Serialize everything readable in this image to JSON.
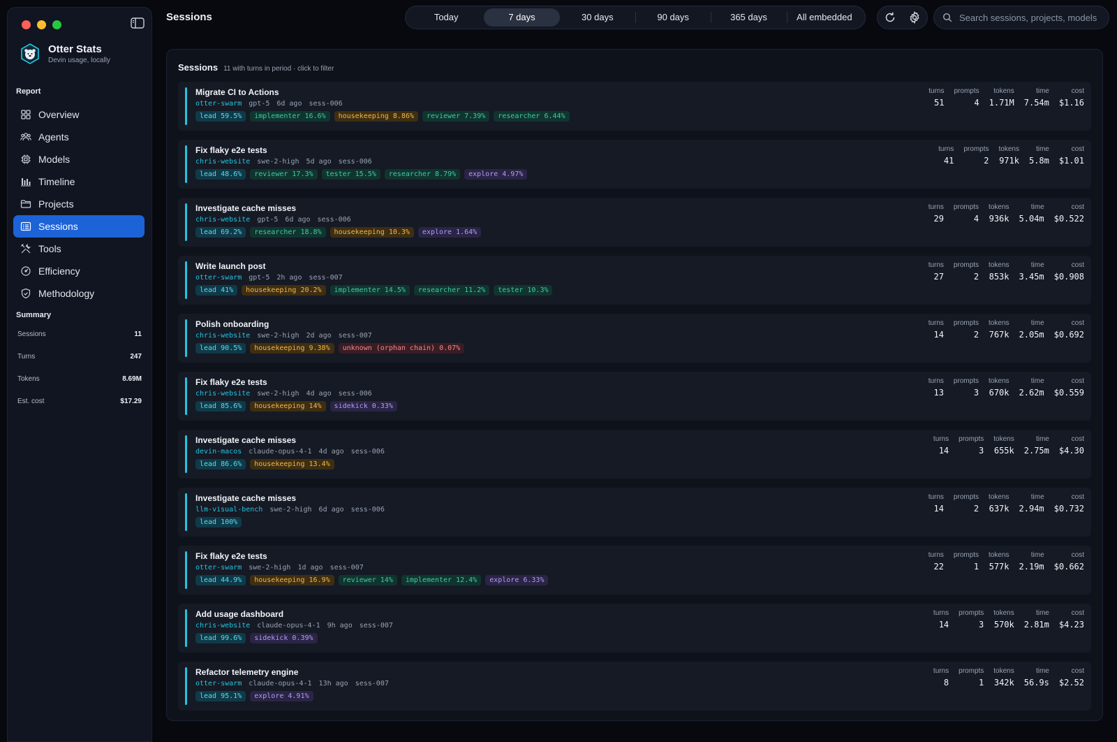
{
  "app": {
    "name": "Otter Stats",
    "subtitle": "Devin usage, locally"
  },
  "header": {
    "title": "Sessions"
  },
  "ranges": [
    {
      "label": "Today",
      "active": false
    },
    {
      "label": "7 days",
      "active": true
    },
    {
      "label": "30 days",
      "active": false
    },
    {
      "label": "90 days",
      "active": false
    },
    {
      "label": "365 days",
      "active": false
    },
    {
      "label": "All embedded",
      "active": false
    }
  ],
  "search": {
    "placeholder": "Search sessions, projects, models"
  },
  "sidebar": {
    "report_label": "Report",
    "items": [
      {
        "label": "Overview",
        "icon": "grid-icon",
        "active": false
      },
      {
        "label": "Agents",
        "icon": "users-icon",
        "active": false
      },
      {
        "label": "Models",
        "icon": "chip-icon",
        "active": false
      },
      {
        "label": "Timeline",
        "icon": "bar-chart-icon",
        "active": false
      },
      {
        "label": "Projects",
        "icon": "folder-icon",
        "active": false
      },
      {
        "label": "Sessions",
        "icon": "list-icon",
        "active": true
      },
      {
        "label": "Tools",
        "icon": "tools-icon",
        "active": false
      },
      {
        "label": "Efficiency",
        "icon": "gauge-icon",
        "active": false
      },
      {
        "label": "Methodology",
        "icon": "shield-icon",
        "active": false
      }
    ],
    "summary_label": "Summary",
    "summary": [
      {
        "label": "Sessions",
        "value": "11"
      },
      {
        "label": "Turns",
        "value": "247"
      },
      {
        "label": "Tokens",
        "value": "8.69M"
      },
      {
        "label": "Est. cost",
        "value": "$17.29"
      }
    ]
  },
  "panel": {
    "title": "Sessions",
    "subtitle": "11 with turns in period · click to filter"
  },
  "stat_labels": {
    "turns": "turns",
    "prompts": "prompts",
    "tokens": "tokens",
    "time": "time",
    "cost": "cost"
  },
  "sessions": [
    {
      "title": "Migrate CI to Actions",
      "project": "otter-swarm",
      "model": "gpt-5",
      "age": "6d ago",
      "id": "sess-006",
      "pills": [
        {
          "t": "lead 59.5%",
          "c": "lead"
        },
        {
          "t": "implementer 16.6%",
          "c": "green"
        },
        {
          "t": "housekeeping 8.86%",
          "c": "housekeeping"
        },
        {
          "t": "reviewer 7.39%",
          "c": "green"
        },
        {
          "t": "researcher 6.44%",
          "c": "green"
        }
      ],
      "turns": "51",
      "prompts": "4",
      "tokens": "1.71M",
      "time": "7.54m",
      "cost": "$1.16"
    },
    {
      "title": "Fix flaky e2e tests",
      "project": "chris-website",
      "model": "swe-2-high",
      "age": "5d ago",
      "id": "sess-006",
      "pills": [
        {
          "t": "lead 48.6%",
          "c": "lead"
        },
        {
          "t": "reviewer 17.3%",
          "c": "green"
        },
        {
          "t": "tester 15.5%",
          "c": "green"
        },
        {
          "t": "researcher 8.79%",
          "c": "green"
        },
        {
          "t": "explore 4.97%",
          "c": "explore"
        }
      ],
      "turns": "41",
      "prompts": "2",
      "tokens": "971k",
      "time": "5.8m",
      "cost": "$1.01"
    },
    {
      "title": "Investigate cache misses",
      "project": "chris-website",
      "model": "gpt-5",
      "age": "6d ago",
      "id": "sess-006",
      "pills": [
        {
          "t": "lead 69.2%",
          "c": "lead"
        },
        {
          "t": "researcher 18.8%",
          "c": "green"
        },
        {
          "t": "housekeeping 10.3%",
          "c": "housekeeping"
        },
        {
          "t": "explore 1.64%",
          "c": "explore"
        }
      ],
      "turns": "29",
      "prompts": "4",
      "tokens": "936k",
      "time": "5.04m",
      "cost": "$0.522"
    },
    {
      "title": "Write launch post",
      "project": "otter-swarm",
      "model": "gpt-5",
      "age": "2h ago",
      "id": "sess-007",
      "pills": [
        {
          "t": "lead 41%",
          "c": "lead"
        },
        {
          "t": "housekeeping 20.2%",
          "c": "housekeeping"
        },
        {
          "t": "implementer 14.5%",
          "c": "green"
        },
        {
          "t": "researcher 11.2%",
          "c": "green"
        },
        {
          "t": "tester 10.3%",
          "c": "green"
        }
      ],
      "turns": "27",
      "prompts": "2",
      "tokens": "853k",
      "time": "3.45m",
      "cost": "$0.908"
    },
    {
      "title": "Polish onboarding",
      "project": "chris-website",
      "model": "swe-2-high",
      "age": "2d ago",
      "id": "sess-007",
      "pills": [
        {
          "t": "lead 90.5%",
          "c": "lead"
        },
        {
          "t": "housekeeping 9.38%",
          "c": "housekeeping"
        },
        {
          "t": "unknown (orphan chain) 0.07%",
          "c": "orphan"
        }
      ],
      "turns": "14",
      "prompts": "2",
      "tokens": "767k",
      "time": "2.05m",
      "cost": "$0.692"
    },
    {
      "title": "Fix flaky e2e tests",
      "project": "chris-website",
      "model": "swe-2-high",
      "age": "4d ago",
      "id": "sess-006",
      "pills": [
        {
          "t": "lead 85.6%",
          "c": "lead"
        },
        {
          "t": "housekeeping 14%",
          "c": "housekeeping"
        },
        {
          "t": "sidekick 0.33%",
          "c": "sidekick"
        }
      ],
      "turns": "13",
      "prompts": "3",
      "tokens": "670k",
      "time": "2.62m",
      "cost": "$0.559"
    },
    {
      "title": "Investigate cache misses",
      "project": "devin-macos",
      "model": "claude-opus-4-1",
      "age": "4d ago",
      "id": "sess-006",
      "pills": [
        {
          "t": "lead 86.6%",
          "c": "lead"
        },
        {
          "t": "housekeeping 13.4%",
          "c": "housekeeping"
        }
      ],
      "turns": "14",
      "prompts": "3",
      "tokens": "655k",
      "time": "2.75m",
      "cost": "$4.30"
    },
    {
      "title": "Investigate cache misses",
      "project": "llm-visual-bench",
      "model": "swe-2-high",
      "age": "6d ago",
      "id": "sess-006",
      "pills": [
        {
          "t": "lead 100%",
          "c": "lead"
        }
      ],
      "turns": "14",
      "prompts": "2",
      "tokens": "637k",
      "time": "2.94m",
      "cost": "$0.732"
    },
    {
      "title": "Fix flaky e2e tests",
      "project": "otter-swarm",
      "model": "swe-2-high",
      "age": "1d ago",
      "id": "sess-007",
      "pills": [
        {
          "t": "lead 44.9%",
          "c": "lead"
        },
        {
          "t": "housekeeping 16.9%",
          "c": "housekeeping"
        },
        {
          "t": "reviewer 14%",
          "c": "green"
        },
        {
          "t": "implementer 12.4%",
          "c": "green"
        },
        {
          "t": "explore 6.33%",
          "c": "explore"
        }
      ],
      "turns": "22",
      "prompts": "1",
      "tokens": "577k",
      "time": "2.19m",
      "cost": "$0.662"
    },
    {
      "title": "Add usage dashboard",
      "project": "chris-website",
      "model": "claude-opus-4-1",
      "age": "9h ago",
      "id": "sess-007",
      "pills": [
        {
          "t": "lead 99.6%",
          "c": "lead"
        },
        {
          "t": "sidekick 0.39%",
          "c": "sidekick"
        }
      ],
      "turns": "14",
      "prompts": "3",
      "tokens": "570k",
      "time": "2.81m",
      "cost": "$4.23"
    },
    {
      "title": "Refactor telemetry engine",
      "project": "otter-swarm",
      "model": "claude-opus-4-1",
      "age": "13h ago",
      "id": "sess-007",
      "pills": [
        {
          "t": "lead 95.1%",
          "c": "lead"
        },
        {
          "t": "explore 4.91%",
          "c": "explore"
        }
      ],
      "turns": "8",
      "prompts": "1",
      "tokens": "342k",
      "time": "56.9s",
      "cost": "$2.52"
    }
  ]
}
